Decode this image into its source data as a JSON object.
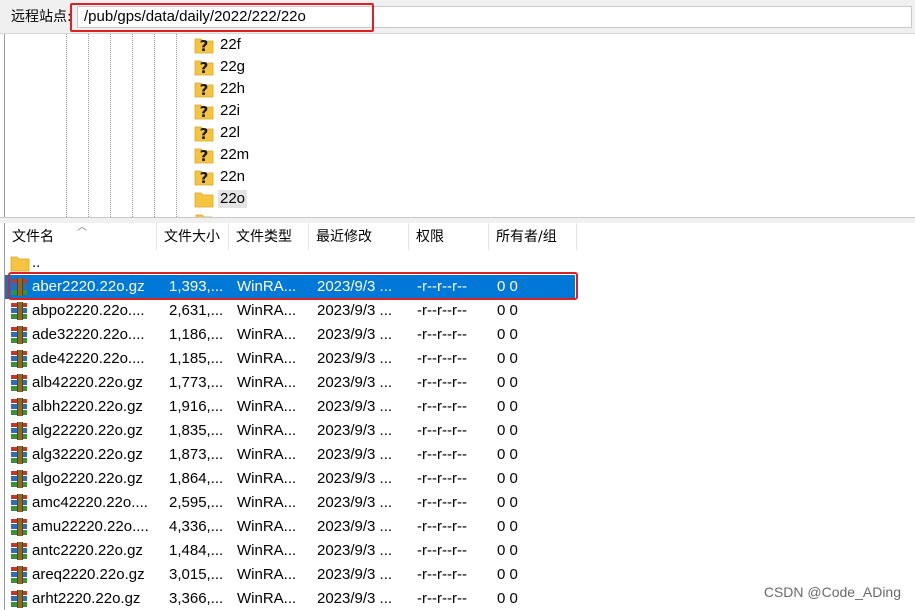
{
  "sitebar": {
    "label": "远程站点:",
    "path": "/pub/gps/data/daily/2022/222/22o"
  },
  "tree": {
    "items": [
      {
        "label": "22f",
        "icon": "question-folder-icon"
      },
      {
        "label": "22g",
        "icon": "question-folder-icon"
      },
      {
        "label": "22h",
        "icon": "question-folder-icon"
      },
      {
        "label": "22i",
        "icon": "question-folder-icon"
      },
      {
        "label": "22l",
        "icon": "question-folder-icon"
      },
      {
        "label": "22m",
        "icon": "question-folder-icon"
      },
      {
        "label": "22n",
        "icon": "question-folder-icon"
      },
      {
        "label": "22o",
        "icon": "folder-icon",
        "selected": true
      }
    ]
  },
  "filelist": {
    "columns": [
      "文件名",
      "文件大小",
      "文件类型",
      "最近修改",
      "权限",
      "所有者/组"
    ],
    "parent_row": "..",
    "rows": [
      {
        "name": "aber2220.22o.gz",
        "size": "1,393,...",
        "type": "WinRA...",
        "modified": "2023/9/3 ...",
        "perm": "-r--r--r--",
        "owner": "0 0",
        "selected": true
      },
      {
        "name": "abpo2220.22o....",
        "size": "2,631,...",
        "type": "WinRA...",
        "modified": "2023/9/3 ...",
        "perm": "-r--r--r--",
        "owner": "0 0"
      },
      {
        "name": "ade32220.22o....",
        "size": "1,186,...",
        "type": "WinRA...",
        "modified": "2023/9/3 ...",
        "perm": "-r--r--r--",
        "owner": "0 0"
      },
      {
        "name": "ade42220.22o....",
        "size": "1,185,...",
        "type": "WinRA...",
        "modified": "2023/9/3 ...",
        "perm": "-r--r--r--",
        "owner": "0 0"
      },
      {
        "name": "alb42220.22o.gz",
        "size": "1,773,...",
        "type": "WinRA...",
        "modified": "2023/9/3 ...",
        "perm": "-r--r--r--",
        "owner": "0 0"
      },
      {
        "name": "albh2220.22o.gz",
        "size": "1,916,...",
        "type": "WinRA...",
        "modified": "2023/9/3 ...",
        "perm": "-r--r--r--",
        "owner": "0 0"
      },
      {
        "name": "alg22220.22o.gz",
        "size": "1,835,...",
        "type": "WinRA...",
        "modified": "2023/9/3 ...",
        "perm": "-r--r--r--",
        "owner": "0 0"
      },
      {
        "name": "alg32220.22o.gz",
        "size": "1,873,...",
        "type": "WinRA...",
        "modified": "2023/9/3 ...",
        "perm": "-r--r--r--",
        "owner": "0 0"
      },
      {
        "name": "algo2220.22o.gz",
        "size": "1,864,...",
        "type": "WinRA...",
        "modified": "2023/9/3 ...",
        "perm": "-r--r--r--",
        "owner": "0 0"
      },
      {
        "name": "amc42220.22o....",
        "size": "2,595,...",
        "type": "WinRA...",
        "modified": "2023/9/3 ...",
        "perm": "-r--r--r--",
        "owner": "0 0"
      },
      {
        "name": "amu22220.22o....",
        "size": "4,336,...",
        "type": "WinRA...",
        "modified": "2023/9/3 ...",
        "perm": "-r--r--r--",
        "owner": "0 0"
      },
      {
        "name": "antc2220.22o.gz",
        "size": "1,484,...",
        "type": "WinRA...",
        "modified": "2023/9/3 ...",
        "perm": "-r--r--r--",
        "owner": "0 0"
      },
      {
        "name": "areq2220.22o.gz",
        "size": "3,015,...",
        "type": "WinRA...",
        "modified": "2023/9/3 ...",
        "perm": "-r--r--r--",
        "owner": "0 0"
      },
      {
        "name": "arht2220.22o.gz",
        "size": "3,366,...",
        "type": "WinRA...",
        "modified": "2023/9/3 ...",
        "perm": "-r--r--r--",
        "owner": "0 0"
      }
    ]
  },
  "watermark": "CSDN @Code_ADing",
  "colors": {
    "selection": "#0078d7",
    "highlight_box": "#e02020",
    "folder": "#f5c542"
  }
}
